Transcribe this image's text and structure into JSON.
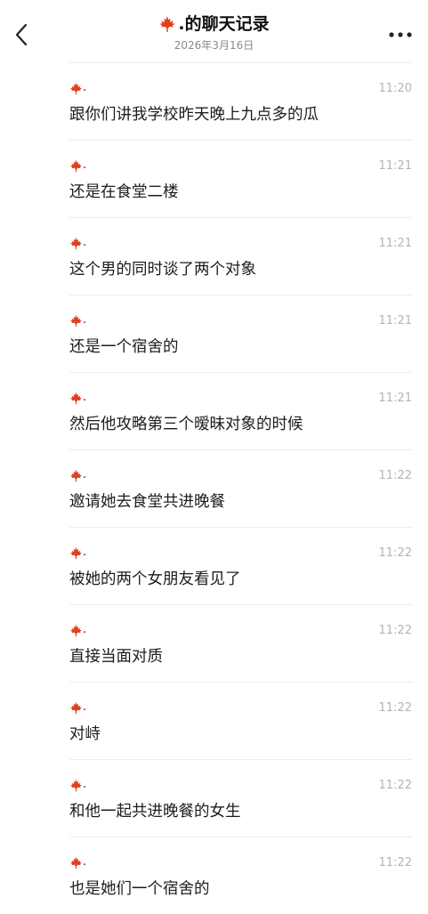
{
  "header": {
    "back_icon": "chevron-left-icon",
    "title_icon": "maple-leaf-icon",
    "title": ".的聊天记录",
    "subtitle": "2026年3月16日",
    "more_icon": "more-horizontal-icon"
  },
  "colors": {
    "leaf": "#e0401a",
    "leaf_dark": "#b52d10",
    "time": "#b4b4b4",
    "divider": "#ececec"
  },
  "messages": [
    {
      "sender": ".",
      "time": "11:20",
      "text": "跟你们讲我学校昨天晚上九点多的瓜"
    },
    {
      "sender": ".",
      "time": "11:21",
      "text": "还是在食堂二楼"
    },
    {
      "sender": ".",
      "time": "11:21",
      "text": "这个男的同时谈了两个对象"
    },
    {
      "sender": ".",
      "time": "11:21",
      "text": "还是一个宿舍的"
    },
    {
      "sender": ".",
      "time": "11:21",
      "text": "然后他攻略第三个暧昧对象的时候"
    },
    {
      "sender": ".",
      "time": "11:22",
      "text": "邀请她去食堂共进晚餐"
    },
    {
      "sender": ".",
      "time": "11:22",
      "text": "被她的两个女朋友看见了"
    },
    {
      "sender": ".",
      "time": "11:22",
      "text": "直接当面对质"
    },
    {
      "sender": ".",
      "time": "11:22",
      "text": "对峙"
    },
    {
      "sender": ".",
      "time": "11:22",
      "text": "和他一起共进晚餐的女生"
    },
    {
      "sender": ".",
      "time": "11:22",
      "text": "也是她们一个宿舍的"
    }
  ]
}
